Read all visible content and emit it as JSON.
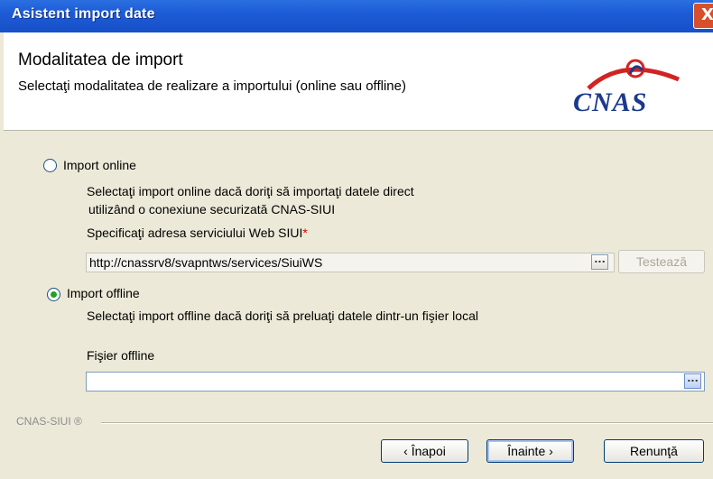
{
  "window": {
    "title": "Asistent import date",
    "close_glyph": "X"
  },
  "header": {
    "title": "Modalitatea de import",
    "subtitle": "Selectaţi modalitatea de realizare a importului (online sau offline)",
    "logo_text": "CNAS"
  },
  "online": {
    "label": "Import online",
    "selected": false,
    "desc_line1": "Selectaţi import online dacă doriţi să importaţi datele direct",
    "desc_line2": "utilizând o conexiune securizată CNAS-SIUI",
    "url_label": "Specificaţi adresa serviciului Web SIUI",
    "required_mark": "*",
    "url_value": "http://cnassrv8/svapntws/services/SiuiWS",
    "browse_label": "...",
    "test_label": "Testează"
  },
  "offline": {
    "label": "Import offline",
    "selected": true,
    "desc": "Selectaţi import offline dacă doriţi să preluaţi datele dintr-un fişier local",
    "file_label": "Fişier offline",
    "file_value": "",
    "browse_label": "..."
  },
  "footer": {
    "brand": "CNAS-SIUI ®",
    "back_label": "‹ Înapoi",
    "next_label": "Înainte ›",
    "cancel_label": "Renunţă"
  },
  "colors": {
    "title_bar": "#1d5bd6",
    "window_bg": "#ece9d8",
    "logo_blue": "#1c3a8c",
    "logo_red": "#d22323",
    "radio_dot": "#21a121"
  }
}
